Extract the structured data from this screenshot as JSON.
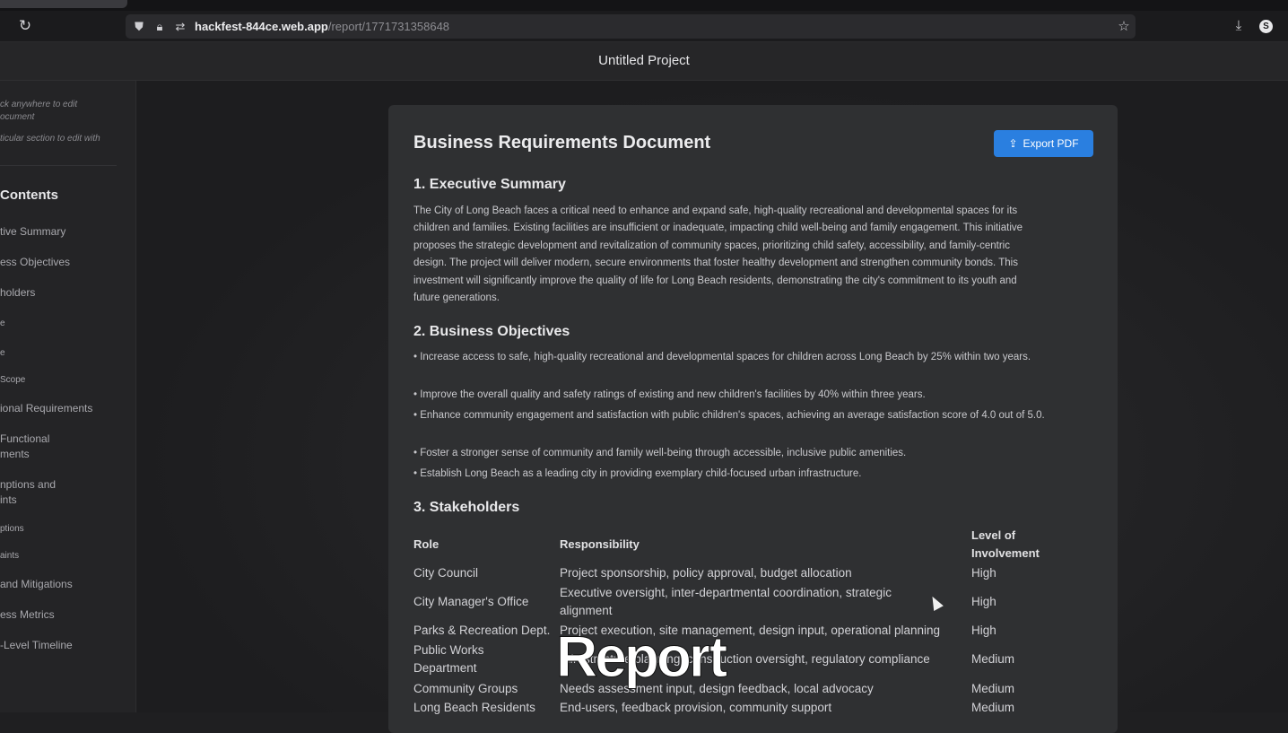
{
  "browser": {
    "reload_icon": "reload-icon",
    "url_host": "hackfest-844ce.web.app",
    "url_path": "/report/1771731358648",
    "account_initial": "S"
  },
  "header": {
    "project_title": "Untitled Project"
  },
  "sidebar": {
    "hints": [
      "ck anywhere to edit",
      "ocument",
      "ticular section to edit with"
    ],
    "contents_heading": "Contents",
    "items": [
      "tive Summary",
      "ess Objectives",
      "holders",
      "e",
      "e",
      "Scope",
      "ional Requirements",
      "Functional",
      "ments",
      "nptions and",
      "ints",
      "ptions",
      "aints",
      " and Mitigations",
      "ess Metrics",
      "-Level Timeline"
    ]
  },
  "document": {
    "title": "Business Requirements Document",
    "export_label": "Export PDF",
    "sections": {
      "exec_summary": {
        "heading": "1. Executive Summary",
        "lines": [
          "The City of Long Beach faces a critical need to enhance and expand safe, high-quality recreational and developmental spaces for its",
          "children and families. Existing facilities are insufficient or inadequate, impacting child well-being and family engagement. This initiative",
          "proposes the strategic development and revitalization of community spaces, prioritizing child safety, accessibility, and family-centric",
          "design. The project will deliver modern, secure environments that foster healthy development and strengthen community bonds. This",
          "investment will significantly improve the quality of life for Long Beach residents, demonstrating the city's commitment to its youth and",
          "future generations."
        ]
      },
      "objectives": {
        "heading": "2. Business Objectives",
        "bullets": [
          "• Increase access to safe, high-quality recreational and developmental spaces for children across Long Beach by 25% within two years.",
          "• Improve the overall quality and safety ratings of existing and new children's facilities by 40% within three years.",
          "• Enhance community engagement and satisfaction with public children's spaces, achieving an average satisfaction score of 4.0 out of 5.0.",
          "• Foster a stronger sense of community and family well-being through accessible, inclusive public amenities.",
          "• Establish Long Beach as a leading city in providing exemplary child-focused urban infrastructure."
        ]
      },
      "stakeholders": {
        "heading": "3. Stakeholders",
        "columns": [
          "Role",
          "Responsibility",
          "Level of Involvement"
        ],
        "rows": [
          [
            "City Council",
            "Project sponsorship, policy approval, budget allocation",
            "High"
          ],
          [
            "City Manager's Office",
            "Executive oversight, inter-departmental coordination, strategic alignment",
            "High"
          ],
          [
            "Parks & Recreation Dept.",
            "Project execution, site management, design input, operational planning",
            "High"
          ],
          [
            "Public Works Department",
            "Infrastructure planning, construction oversight, regulatory compliance",
            "Medium"
          ],
          [
            "Community Groups",
            "Needs assessment input, design feedback, local advocacy",
            "Medium"
          ],
          [
            "Long Beach Residents",
            "End-users, feedback provision, community support",
            "Medium"
          ]
        ]
      }
    }
  },
  "overlay": {
    "caption": "Report"
  }
}
